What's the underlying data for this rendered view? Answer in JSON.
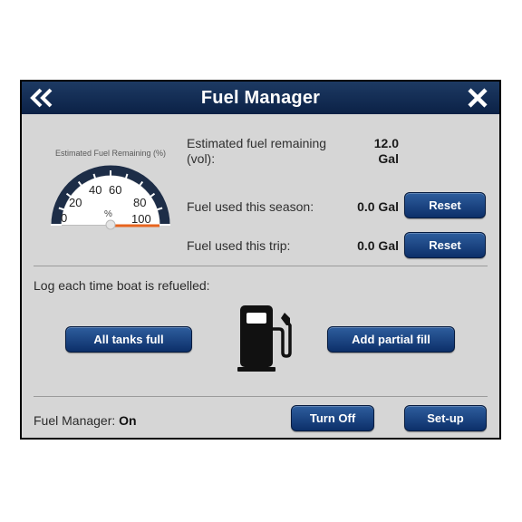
{
  "window": {
    "title": "Fuel Manager",
    "back_icon": "double-chevron-left-icon",
    "close_icon": "close-x-icon"
  },
  "gauge": {
    "caption": "Estimated Fuel Remaining (%)",
    "ticks": [
      "0",
      "20",
      "40",
      "60",
      "80",
      "100"
    ],
    "unit": "%",
    "value_percent": 100,
    "accent_color": "#e8641e"
  },
  "stats": {
    "remaining_label_line1": "Estimated fuel remaining",
    "remaining_label_line2": "(vol):",
    "remaining_value": "12.0",
    "remaining_unit": "Gal",
    "season_label": "Fuel used this season:",
    "season_value": "0.0 Gal",
    "season_reset": "Reset",
    "trip_label": "Fuel used this trip:",
    "trip_value": "0.0 Gal",
    "trip_reset": "Reset"
  },
  "log": {
    "instruction": "Log each time boat is refuelled:",
    "all_full_label": "All tanks full",
    "partial_label": "Add partial fill",
    "pump_icon": "fuel-pump-icon"
  },
  "footer": {
    "status_label": "Fuel Manager:",
    "status_value": "On",
    "turn_off_label": "Turn Off",
    "setup_label": "Set-up"
  },
  "colors": {
    "title_bar": "#0b2146",
    "button": "#0c2f69",
    "panel": "#d6d6d6"
  }
}
